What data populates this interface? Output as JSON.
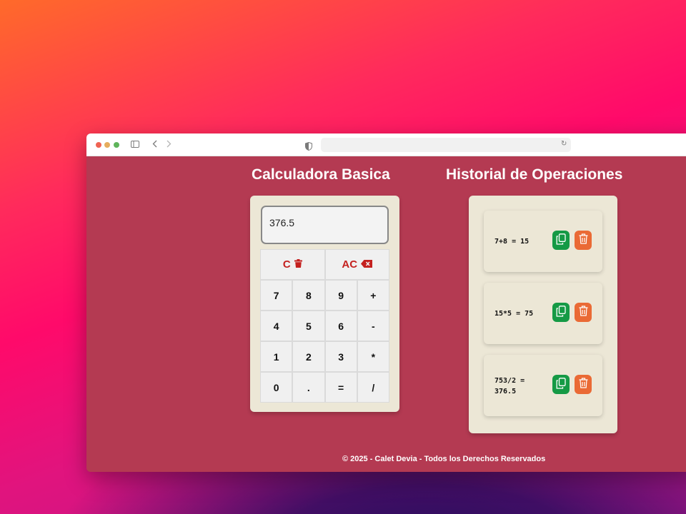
{
  "browser": {
    "traffic_lights": {
      "red": "#ef6353",
      "yellow": "#e6ad5d",
      "green": "#5fb45b"
    },
    "icons": [
      "sidebar-icon",
      "back-icon",
      "forward-icon",
      "shield-icon",
      "reload-icon"
    ],
    "address": ""
  },
  "page": {
    "calc_title": "Calculadora Basica",
    "history_title": "Historial de Operaciones",
    "footer": "© 2025 - Calet Devia - Todos los Derechos Reservados",
    "background_color": "#b43a52",
    "card_color": "#ece7d6"
  },
  "calculator": {
    "display_value": "376.5",
    "clear_label": "C",
    "clear_icon": "trash-icon",
    "all_clear_label": "AC",
    "all_clear_icon": "backspace-icon",
    "keys": [
      [
        "7",
        "8",
        "9",
        "+"
      ],
      [
        "4",
        "5",
        "6",
        "-"
      ],
      [
        "1",
        "2",
        "3",
        "*"
      ],
      [
        "0",
        ".",
        "=",
        "/"
      ]
    ],
    "accent_color": "#c4211f"
  },
  "history": {
    "items": [
      {
        "text": "7+8 = 15"
      },
      {
        "text": "15*5 = 75"
      },
      {
        "text": "753/2 = 376.5"
      }
    ],
    "copy_icon": "copy-icon",
    "delete_icon": "trash-icon",
    "copy_color": "#159a45",
    "delete_color": "#ea6a35"
  }
}
